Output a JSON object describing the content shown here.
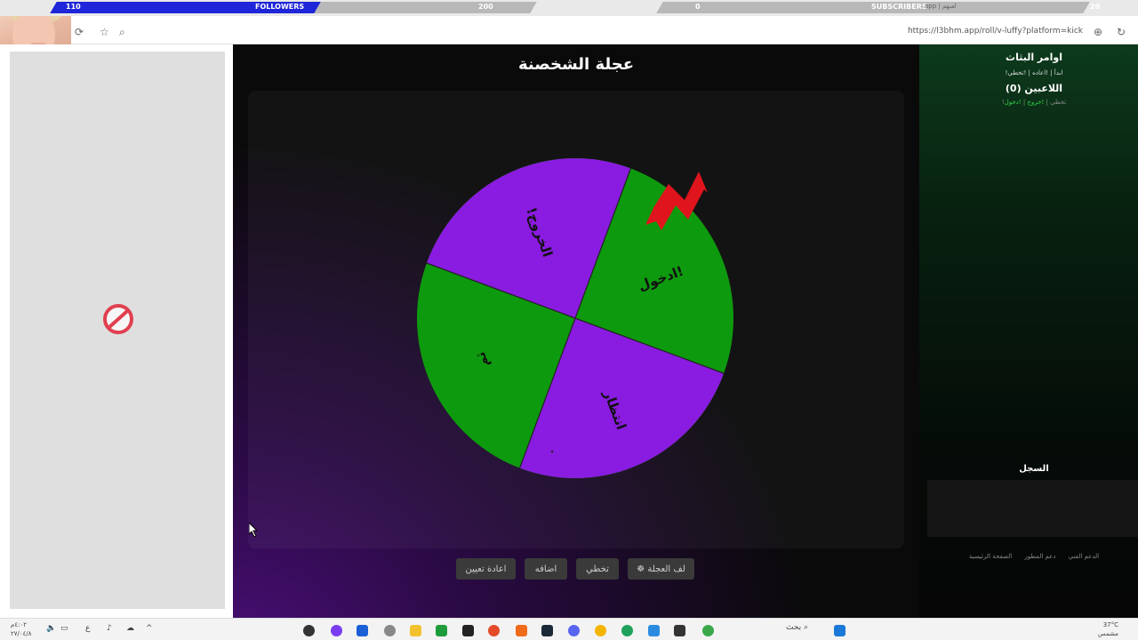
{
  "overlay": {
    "followers_current": "110",
    "followers_label": "FOLLOWERS",
    "followers_goal": "200",
    "followers_progress": 0.55,
    "subscribers_current": "0",
    "subscribers_label": "SUBSCRIBERS",
    "subscribers_goal": "20"
  },
  "browser": {
    "url": "https://l3bhm.app/roll/v-luffy?platform=kick",
    "tab_fragment": "app | لعبهم"
  },
  "app": {
    "title": "عجلة الشخصنة",
    "wheel_segments": [
      {
        "label": "ادخول!",
        "color": "#0e9a0e"
      },
      {
        "label": "انتظار",
        "color": "#8a1be0"
      },
      {
        "label": "ثم",
        "color": "#0e9a0e"
      },
      {
        "label": "!الخروج",
        "color": "#8a1be0"
      }
    ],
    "buttons": {
      "spin": "لف العجلة",
      "skip": "تخطي",
      "add": "اضافه",
      "reset": "اعادة تعيين"
    }
  },
  "panel": {
    "heading": "اوامر البثاث",
    "commands": "!ابدأ | !اعاده | !تخطي",
    "players": "اللاعبين (0)",
    "link_enter": "!دخول",
    "link_exit": "!خروج",
    "link_skip": "!تخطي",
    "log_title": "السجل",
    "footer_home": "الصفحة الرئيسية",
    "footer_dev": "دعم المطور",
    "footer_support": "الدعم الفني"
  },
  "taskbar": {
    "search": "بحث",
    "temp": "37°C",
    "weather": "مشمس"
  },
  "colors": {
    "wheel_green": "#0e9a0e",
    "wheel_purple": "#8a1be0",
    "accent_red": "#e0141c",
    "follower_bar": "#1f26d9"
  }
}
